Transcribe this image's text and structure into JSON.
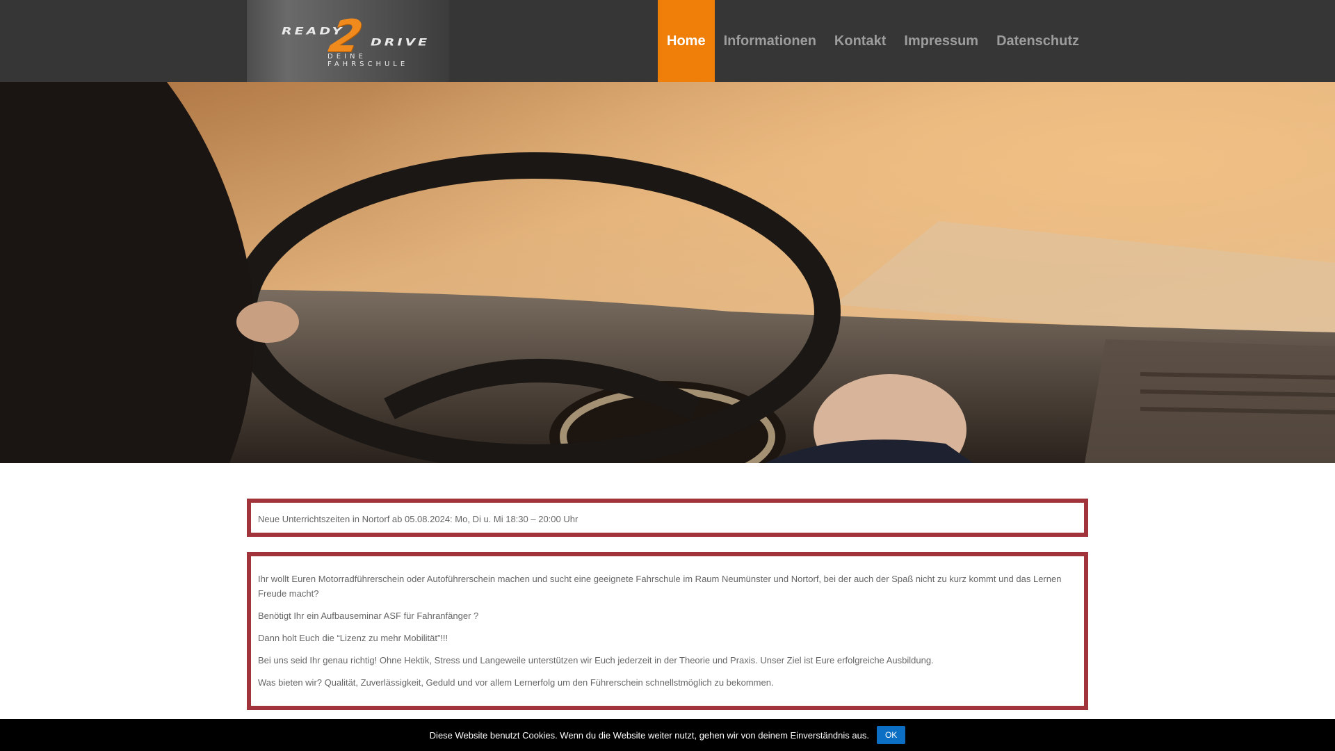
{
  "logo": {
    "word_left": "READY",
    "numeral": "2",
    "word_right": "DRIVE",
    "tagline": "DEINE FAHRSCHULE"
  },
  "nav": {
    "items": [
      {
        "label": "Home",
        "active": true
      },
      {
        "label": "Informationen"
      },
      {
        "label": "Kontakt"
      },
      {
        "label": "Impressum"
      },
      {
        "label": "Datenschutz"
      }
    ]
  },
  "colors": {
    "header_bg": "#363636",
    "accent": "#f07f09",
    "box_border": "#a1343a",
    "cookie_button": "#0c6fc4"
  },
  "notice": {
    "text": "Neue Unterrichtszeiten in Nortorf ab 05.08.2024: Mo, Di u. Mi 18:30 – 20:00 Uhr"
  },
  "intro": {
    "paragraphs": [
      "Ihr wollt Euren Motorradführerschein oder Autoführerschein machen und sucht eine geeignete Fahrschule im Raum Neumünster und Nortorf, bei der auch der Spaß nicht zu kurz kommt und das Lernen Freude macht?",
      "Benötigt Ihr ein Aufbauseminar ASF für Fahranfänger ?",
      "Dann holt Euch die “Lizenz zu mehr Mobilität”!!!",
      "Bei uns seid Ihr genau richtig! Ohne Hektik, Stress und Langeweile unterstützen wir Euch jederzeit in der Theorie und Praxis. Unser Ziel ist Eure erfolgreiche Ausbildung.",
      "Was bieten wir? Qualität, Zuverlässigkeit, Geduld und vor allem Lernerfolg um den Führerschein schnellstmöglich zu bekommen."
    ]
  },
  "cookie": {
    "text": "Diese Website benutzt Cookies. Wenn du die Website weiter nutzt, gehen wir von deinem Einverständnis aus.",
    "button": "OK"
  }
}
